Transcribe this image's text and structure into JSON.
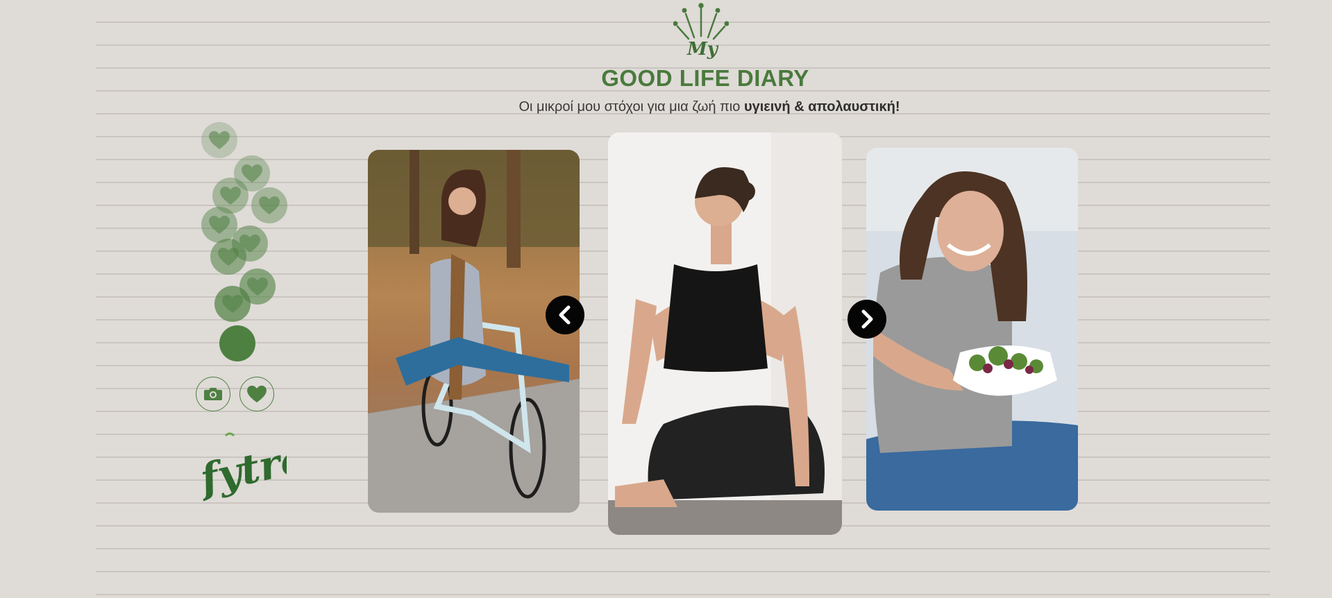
{
  "header": {
    "brand_prefix": "My",
    "title": "GOOD LIFE DIARY",
    "subtitle_plain": "Οι μικροί μου στόχοι για μια ζωή πιο ",
    "subtitle_bold": "υγιεινή & απολαυστική!"
  },
  "side": {
    "heart_icon": "heart-icon",
    "camera_icon": "camera-icon",
    "logo_text": "fytro"
  },
  "carousel": {
    "slides": [
      {
        "scene": "woman-on-bicycle"
      },
      {
        "scene": "woman-yoga-pose"
      },
      {
        "scene": "woman-eating-salad"
      }
    ],
    "prev_icon": "chevron-left-icon",
    "next_icon": "chevron-right-icon"
  },
  "colors": {
    "background": "#dfdbd7",
    "brand_green": "#4a7a3d",
    "nav_button": "#050505"
  }
}
